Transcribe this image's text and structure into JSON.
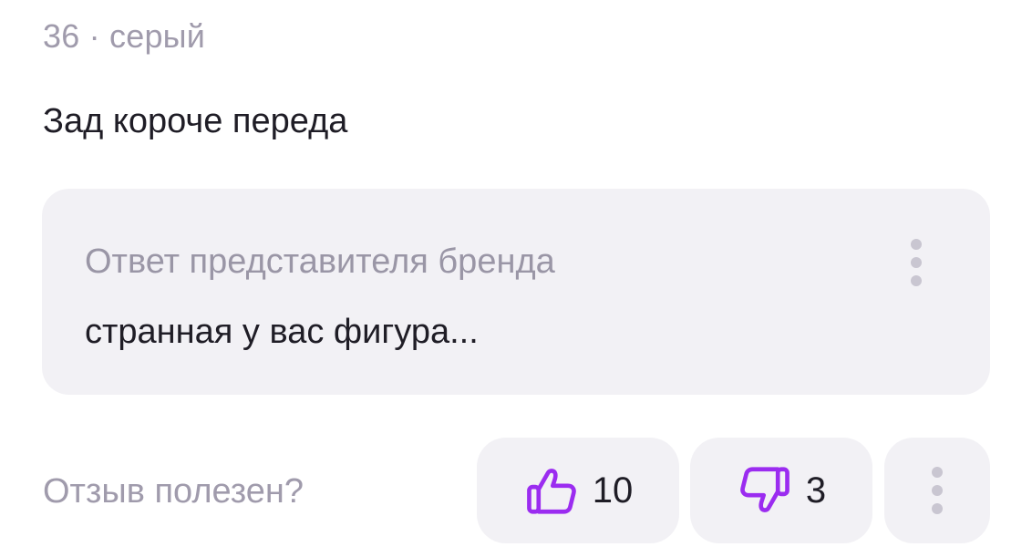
{
  "review": {
    "meta": "36 · серый",
    "text": "Зад короче переда"
  },
  "brand_reply": {
    "title": "Ответ представителя бренда",
    "text": "странная у вас фигура..."
  },
  "feedback": {
    "question": "Отзыв полезен?",
    "likes": "10",
    "dislikes": "3"
  },
  "colors": {
    "accent": "#9b2cf0",
    "muted_text": "#a09bac",
    "main_text": "#1f1d26",
    "card_bg": "#f2f1f5"
  },
  "icons": {
    "like": "thumbs-up-icon",
    "dislike": "thumbs-down-icon",
    "more": "more-vertical-icon"
  }
}
